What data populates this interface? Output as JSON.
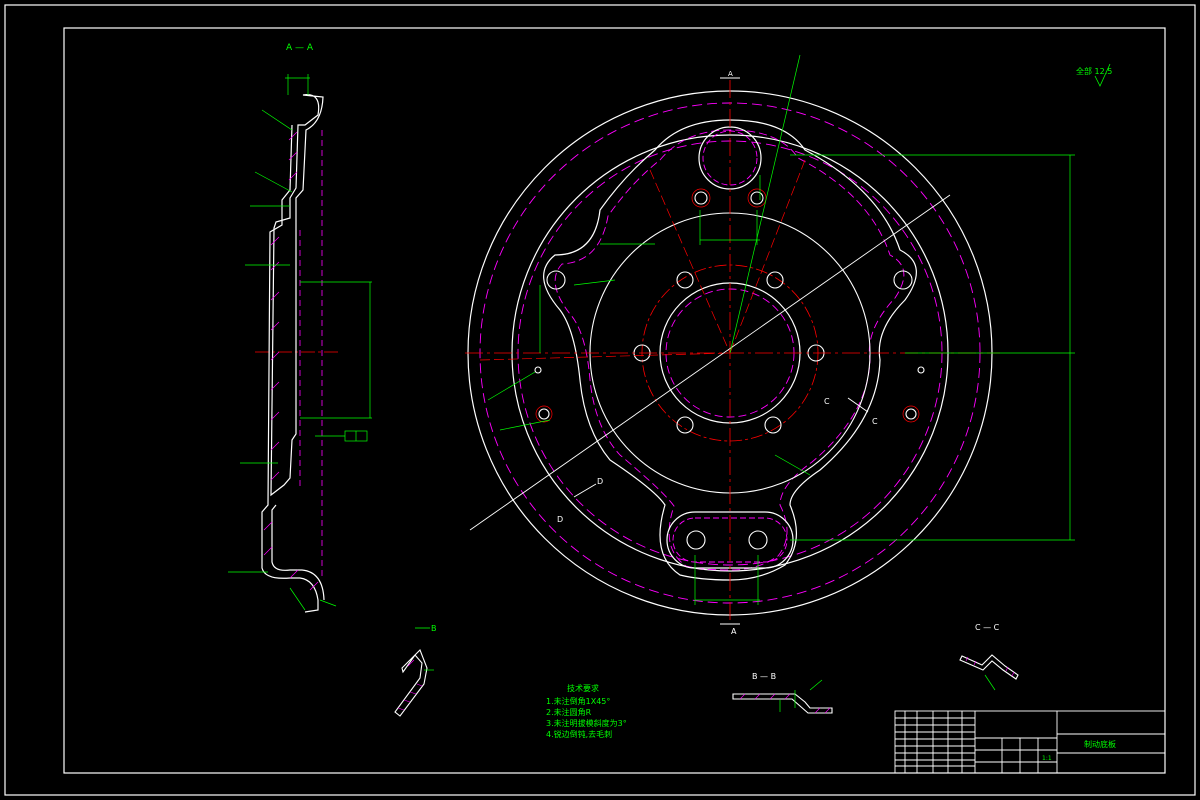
{
  "colors": {
    "background": "#000000",
    "outline": "#ffffff",
    "dimension": "#00ff00",
    "hidden": "#ff00ff",
    "centerline": "#ff0000",
    "title": "#00ffff"
  },
  "section_labels": {
    "aa": "A — A",
    "bb": "B — B",
    "cc": "C — C",
    "b_marker": "B",
    "a_top": "A",
    "a_bottom": "A",
    "c_left": "C",
    "c_right": "C",
    "d_top": "D",
    "d_bottom": "D"
  },
  "roughness": "全部 12.5",
  "technical_requirements": {
    "title": "技术要求",
    "items": [
      "1.未注倒角1X45°",
      "2.未注圆角R",
      "3.未注明拔模斜度为3°",
      "4.锐边倒钝,去毛刺"
    ]
  },
  "title_block": {
    "part_name": "制动底板",
    "scale": "1:1"
  }
}
